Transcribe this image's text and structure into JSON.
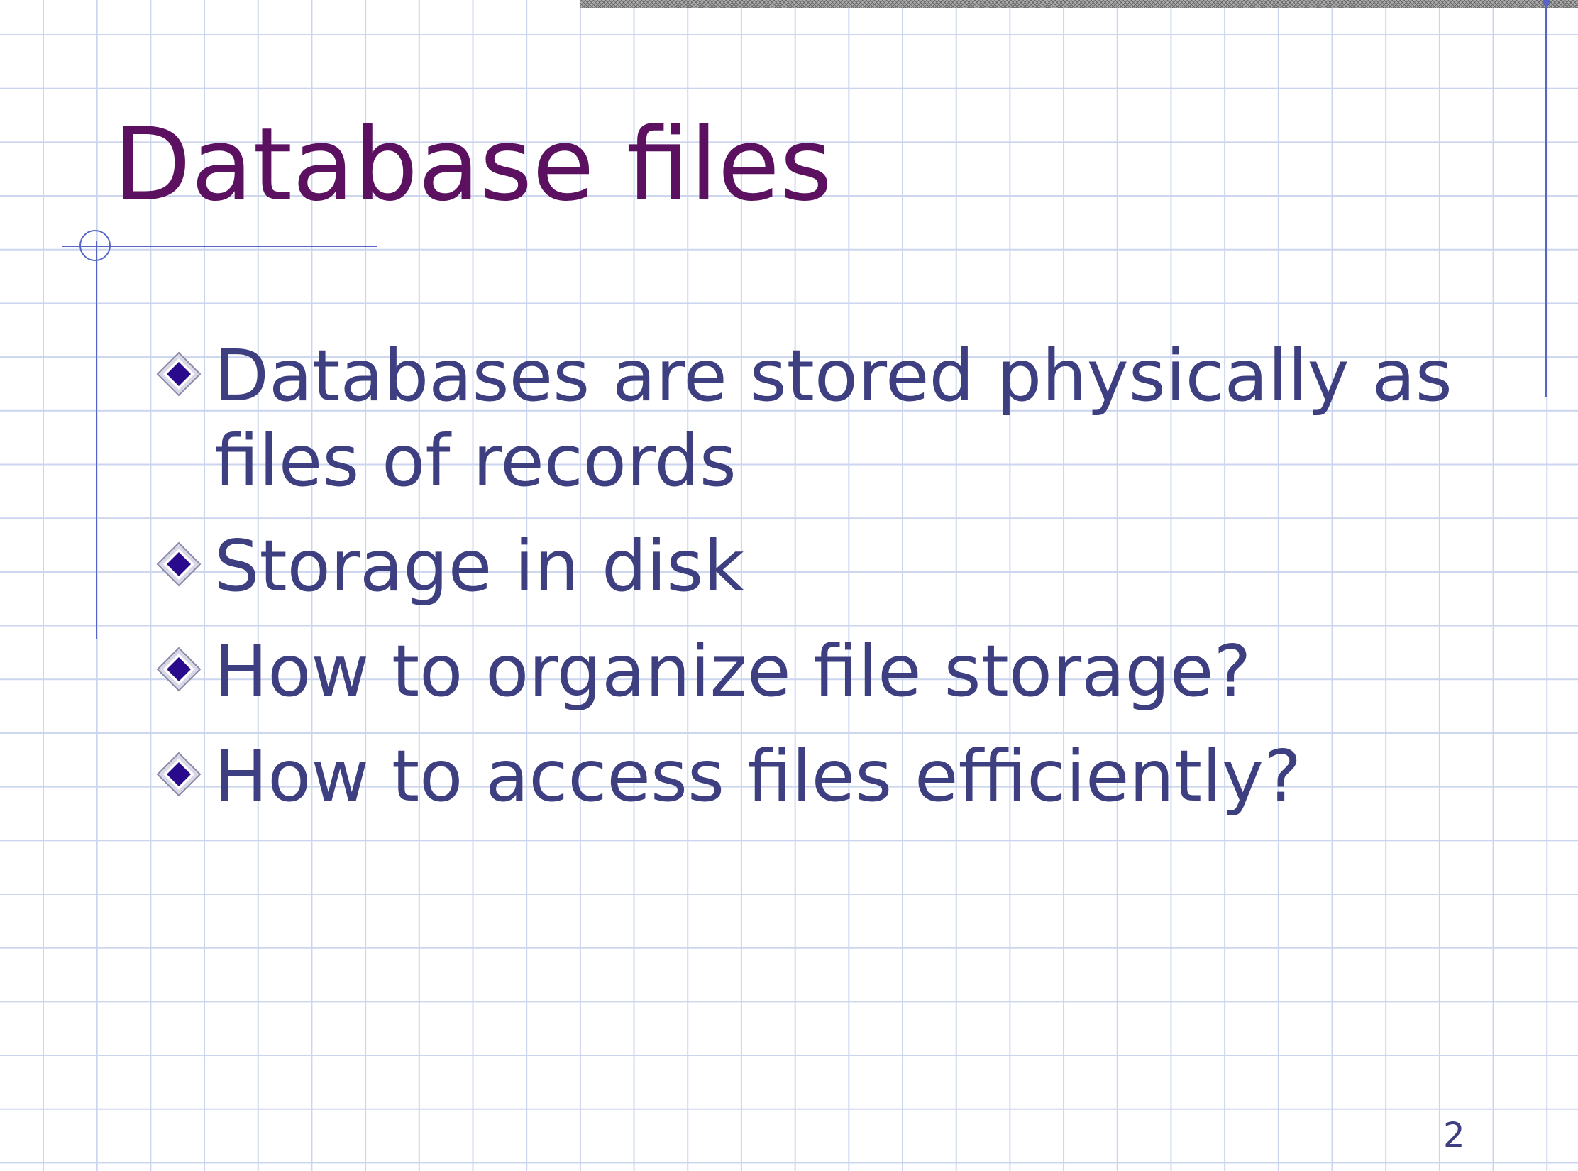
{
  "slide": {
    "title": "Database files",
    "bullets": [
      "Databases are stored physically as files of records",
      "Storage in disk",
      "How to organize file storage?",
      "How to access files efficiently?"
    ],
    "bullet_icon": "diamond-bullet-icon",
    "page_number": "2"
  },
  "colors": {
    "title": "#5c1060",
    "body_text": "#3d3f80",
    "bullet_fill": "#2a0a8c",
    "rule_lines": "#5566c8",
    "grid": "#ccd5ee"
  }
}
